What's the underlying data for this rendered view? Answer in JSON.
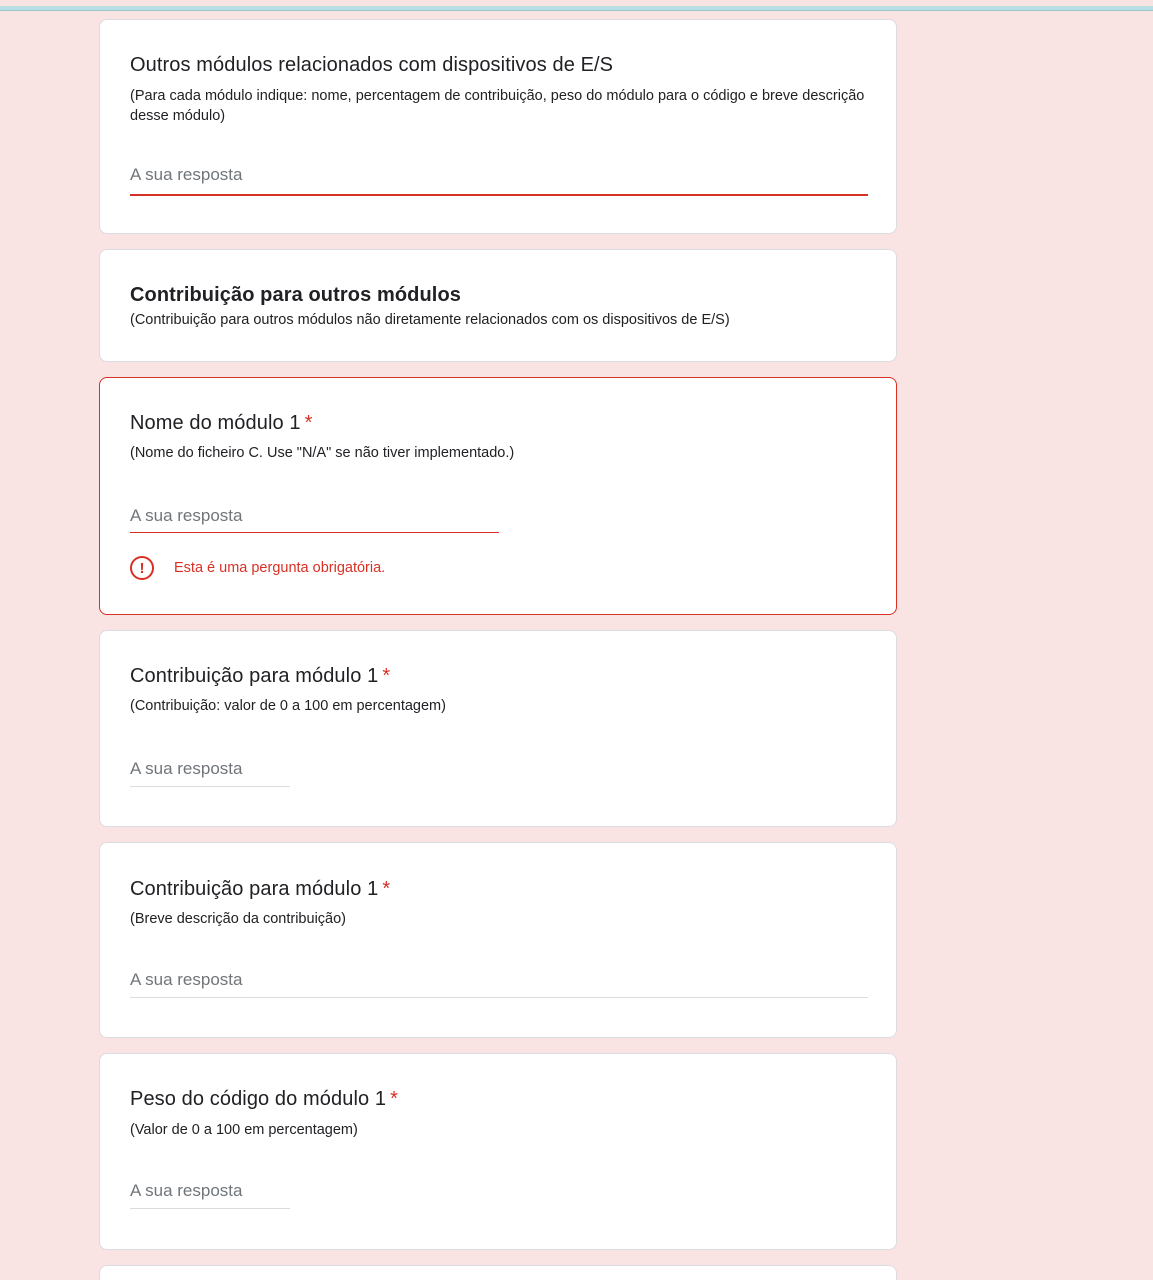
{
  "placeholder": "A sua resposta",
  "cards": [
    {
      "title": "Outros módulos relacionados com dispositivos de E/S",
      "description": "(Para cada módulo indique: nome, percentagem de contribuição, peso do módulo para o código e breve descrição desse módulo)"
    },
    {
      "title": "Contribuição para outros módulos",
      "description": "(Contribuição para outros módulos não diretamente relacionados com os dispositivos de E/S)"
    },
    {
      "title": "Nome do módulo 1",
      "required_mark": "*",
      "description": "(Nome do ficheiro C. Use \"N/A\" se não tiver implementado.)",
      "error": "Esta é uma pergunta obrigatória.",
      "error_icon": "exclamation-circle-icon"
    },
    {
      "title": "Contribuição para módulo 1",
      "required_mark": "*",
      "description": "(Contribuição: valor de 0 a 100 em percentagem)"
    },
    {
      "title": "Contribuição para módulo 1",
      "required_mark": "*",
      "description": "(Breve descrição da contribuição)"
    },
    {
      "title": "Peso do código do módulo 1",
      "required_mark": "*",
      "description": "(Valor de 0 a 100 em percentagem)"
    }
  ],
  "colors": {
    "background": "#fae3e3",
    "error": "#d93025",
    "card": "#ffffff"
  }
}
